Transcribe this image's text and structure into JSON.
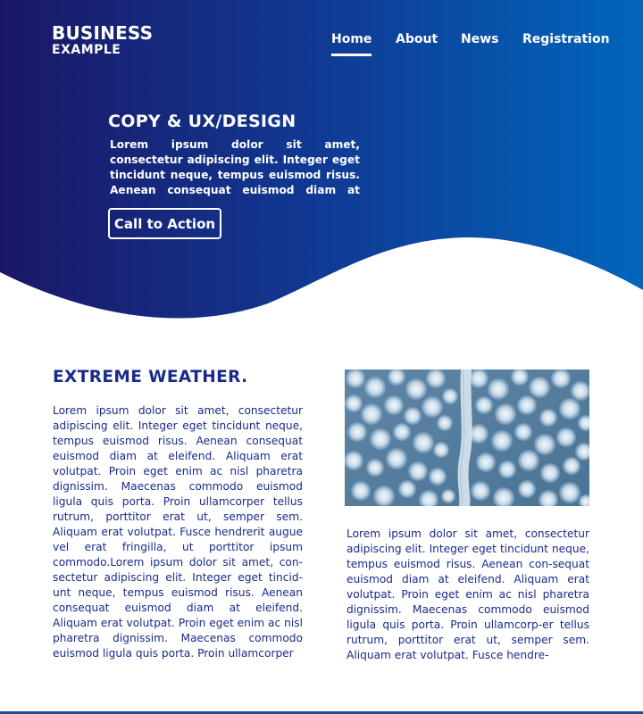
{
  "colors": {
    "hero_gradient_start": "#1b1766",
    "hero_gradient_end": "#0066bb",
    "heading_blue": "#1a2a8a",
    "text_blue": "#1a2a8a",
    "white": "#ffffff"
  },
  "logo": {
    "line1": "BUSINESS",
    "line2": "EXAMPLE"
  },
  "nav": {
    "items": [
      {
        "label": "Home",
        "active": true
      },
      {
        "label": "About",
        "active": false
      },
      {
        "label": "News",
        "active": false
      },
      {
        "label": "Registration",
        "active": false
      }
    ]
  },
  "hero": {
    "title": "COPY & UX/DESIGN",
    "text": "Lorem ipsum dolor sit amet, consectetur adipiscing elit. Integer eget tincidunt neque, tempus euismod risus. Aenean consequat euismod diam at eleifend. Aliquam erat",
    "cta_label": "Call to Action"
  },
  "section": {
    "title": "EXTREME WEATHER.",
    "left_text": "Lorem ipsum dolor sit amet, consectetur adipiscing elit. Integer eget tincidunt neque, tempus euismod risus. Aenean consequat euismod diam at eleifend. Aliquam erat volutpat. Proin eget enim ac nisl pharetra dignissim. Maecenas commodo euismod ligula quis porta. Proin ullamcorper tellus rutrum, porttitor erat ut, semper sem. Aliquam erat volutpat. Fusce hendrerit augue vel erat fringilla, ut porttitor ipsum commodo.Lorem ipsum dolor sit amet, con-sectetur adipiscing elit. Integer eget tincid-unt neque, tempus euismod risus. Aenean consequat euismod diam at eleifend. Aliquam erat volutpat. Proin eget enim ac nisl pharetra dignissim. Maecenas commodo euismod ligula quis porta. Proin ullamcorper",
    "right_text": "Lorem ipsum dolor sit amet, consectetur adipiscing elit. Integer eget tincidunt neque, tempus euismod risus. Aenean con-sequat euismod diam at eleifend. Aliquam erat volutpat. Proin eget enim ac nisl pharetra dignissim. Maecenas commodo euismod ligula quis porta. Proin ullamcorp-er tellus rutrum, porttitor erat ut, semper sem. Aliquam erat volutpat. Fusce hendre-",
    "image_subject": "snowy-forest-aerial"
  }
}
